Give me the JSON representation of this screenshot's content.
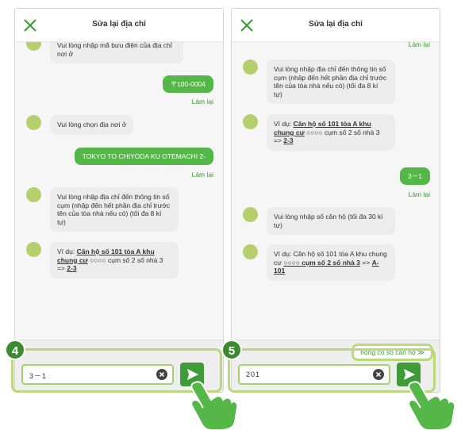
{
  "header": {
    "title": "Sửa lại địa chỉ"
  },
  "left": {
    "step": "4",
    "partial_message": "Vui lòng nhập mã bưu điện của địa chỉ nơi ở",
    "user_postcode": "〒100-0004",
    "redo_1": "Làm lại",
    "choose_msg": "Vui lòng chọn địa nơi ở",
    "user_address": "TOKYO TO CHIYODA KU OTEMACHI 2-",
    "redo_2": "Làm lại",
    "block_msg": "Vui lòng nhập địa chỉ đến thông tin số cụm (nhập đến hết phần địa chỉ trước tên của tòa nhà nếu có) (tối đa 8 kí tự)",
    "example": {
      "prefix": "Ví dụ: ",
      "bold": "Căn hộ số 101 tòa A khu chung cư",
      "middle": " ○○○○ cụm số 2 số nhà 3 => ",
      "answer": "2-3"
    },
    "input_value": "3－1"
  },
  "right": {
    "step": "5",
    "redo_top": "Làm lại",
    "block_msg": "Vui lòng nhập địa chỉ đến thông tin số cụm (nhập đến hết phần địa chỉ trước tên của tòa nhà nếu có) (tối đa 8 kí tự)",
    "example1": {
      "prefix": "Ví dụ: ",
      "bold": "Căn hộ số 101 tòa A khu chung cư",
      "middle": " ○○○○ cụm số 2 số nhà 3 => ",
      "answer": "2-3"
    },
    "user_block": "3－1",
    "redo": "Làm lại",
    "apt_msg": "Vui lòng nhập số căn hộ (tối đa 30 kí tự)",
    "example2": {
      "prefix": "Ví dụ: Căn hộ số 101 tòa A khu chung cư ",
      "bold": "○○○○ cụm số 2 số nhà 3",
      "middle": " => ",
      "answer": "A-101"
    },
    "no_apt_button": "hông có số căn hộ ≫",
    "input_value": "201"
  },
  "colors": {
    "brand_green": "#55b748",
    "highlight": "#b9d97a",
    "badge": "#3c8c2f"
  }
}
